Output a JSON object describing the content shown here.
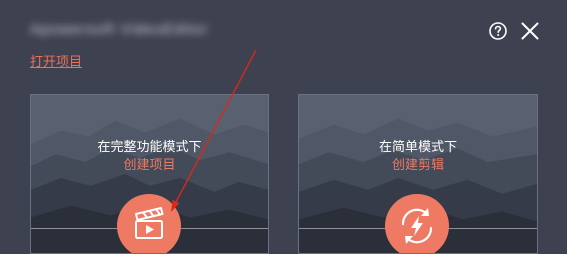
{
  "window": {
    "title": "Apowersoft VideoEditor",
    "help_icon": "help-circle-icon",
    "close_icon": "close-icon"
  },
  "open_project": {
    "label": "打开项目"
  },
  "cards": [
    {
      "id": "full",
      "line1": "在完整功能模式下",
      "line2": "创建项目",
      "icon": "clapperboard-icon"
    },
    {
      "id": "simple",
      "line1": "在简单模式下",
      "line2": "创建剪辑",
      "icon": "refresh-lightning-icon"
    }
  ],
  "colors": {
    "background": "#3e4150",
    "accent": "#ee7a63",
    "annotation_arrow": "#d42a1f"
  }
}
